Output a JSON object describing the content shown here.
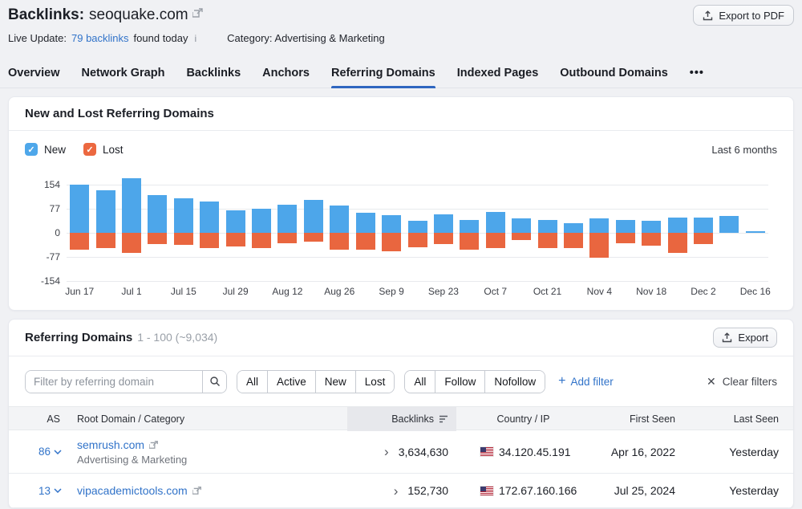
{
  "header": {
    "title_prefix": "Backlinks:",
    "domain": "seoquake.com",
    "export_pdf_label": "Export to PDF",
    "live_update_label": "Live Update:",
    "live_update_link": "79 backlinks",
    "live_update_suffix": "found today",
    "info_icon": "i",
    "category_label": "Category: Advertising & Marketing"
  },
  "tabs": [
    {
      "label": "Overview",
      "active": false
    },
    {
      "label": "Network Graph",
      "active": false
    },
    {
      "label": "Backlinks",
      "active": false
    },
    {
      "label": "Anchors",
      "active": false
    },
    {
      "label": "Referring Domains",
      "active": true
    },
    {
      "label": "Indexed Pages",
      "active": false
    },
    {
      "label": "Outbound Domains",
      "active": false
    },
    {
      "label": "•••",
      "active": false
    }
  ],
  "accent_color": "#2e66c0",
  "chart_card": {
    "title": "New and Lost Referring Domains",
    "legend_new": "New",
    "legend_lost": "Lost",
    "check_glyph": "✓",
    "range_label": "Last 6 months"
  },
  "chart_data": {
    "type": "bar",
    "subtype": "diverging-stacked-weekly",
    "title": "New and Lost Referring Domains",
    "x": [
      "Jun 17",
      "Jun 24",
      "Jul 1",
      "Jul 8",
      "Jul 15",
      "Jul 22",
      "Jul 29",
      "Aug 5",
      "Aug 12",
      "Aug 19",
      "Aug 26",
      "Sep 2",
      "Sep 9",
      "Sep 16",
      "Sep 23",
      "Sep 30",
      "Oct 7",
      "Oct 14",
      "Oct 21",
      "Oct 28",
      "Nov 4",
      "Nov 11",
      "Nov 18",
      "Nov 25",
      "Dec 2",
      "Dec 9",
      "Dec 16"
    ],
    "series": [
      {
        "name": "New",
        "color": "#4da6ea",
        "values": [
          154,
          135,
          175,
          120,
          110,
          100,
          72,
          77,
          91,
          104,
          87,
          65,
          56,
          38,
          60,
          42,
          67,
          47,
          41,
          32,
          45,
          42,
          38,
          50,
          49,
          54,
          5
        ]
      },
      {
        "name": "Lost",
        "color": "#e9663f",
        "values": [
          -55,
          -50,
          -65,
          -35,
          -38,
          -48,
          -43,
          -50,
          -33,
          -28,
          -55,
          -53,
          -59,
          -46,
          -37,
          -55,
          -48,
          -24,
          -50,
          -50,
          -80,
          -33,
          -40,
          -64,
          -35,
          0,
          0
        ]
      }
    ],
    "x_tick_every": 2,
    "y_ticks": [
      154,
      77,
      0,
      -77,
      -154
    ],
    "ylim": [
      -154,
      175
    ],
    "grid": true,
    "legend_position": "top-left"
  },
  "table_card": {
    "title": "Referring Domains",
    "range": "1 - 100 (~9,034)",
    "export_label": "Export",
    "filter_placeholder": "Filter by referring domain",
    "filter_groups": [
      [
        "All",
        "Active",
        "New",
        "Lost"
      ],
      [
        "All",
        "Follow",
        "Nofollow"
      ]
    ],
    "add_filter_icon": "+",
    "add_filter_label": "Add filter",
    "clear_icon": "✕",
    "clear_filters_label": "Clear filters",
    "columns": [
      "AS",
      "Root Domain / Category",
      "Backlinks",
      "Country / IP",
      "First Seen",
      "Last Seen"
    ],
    "sorted_column": "Backlinks",
    "expand_glyph": "›",
    "rows": [
      {
        "as": "86",
        "domain": "semrush.com",
        "category": "Advertising & Marketing",
        "backlinks": "3,634,630",
        "country": "US",
        "ip": "34.120.45.191",
        "first_seen": "Apr 16, 2022",
        "last_seen": "Yesterday"
      },
      {
        "as": "13",
        "domain": "vipacademictools.com",
        "category": "",
        "backlinks": "152,730",
        "country": "US",
        "ip": "172.67.160.166",
        "first_seen": "Jul 25, 2024",
        "last_seen": "Yesterday"
      }
    ]
  }
}
